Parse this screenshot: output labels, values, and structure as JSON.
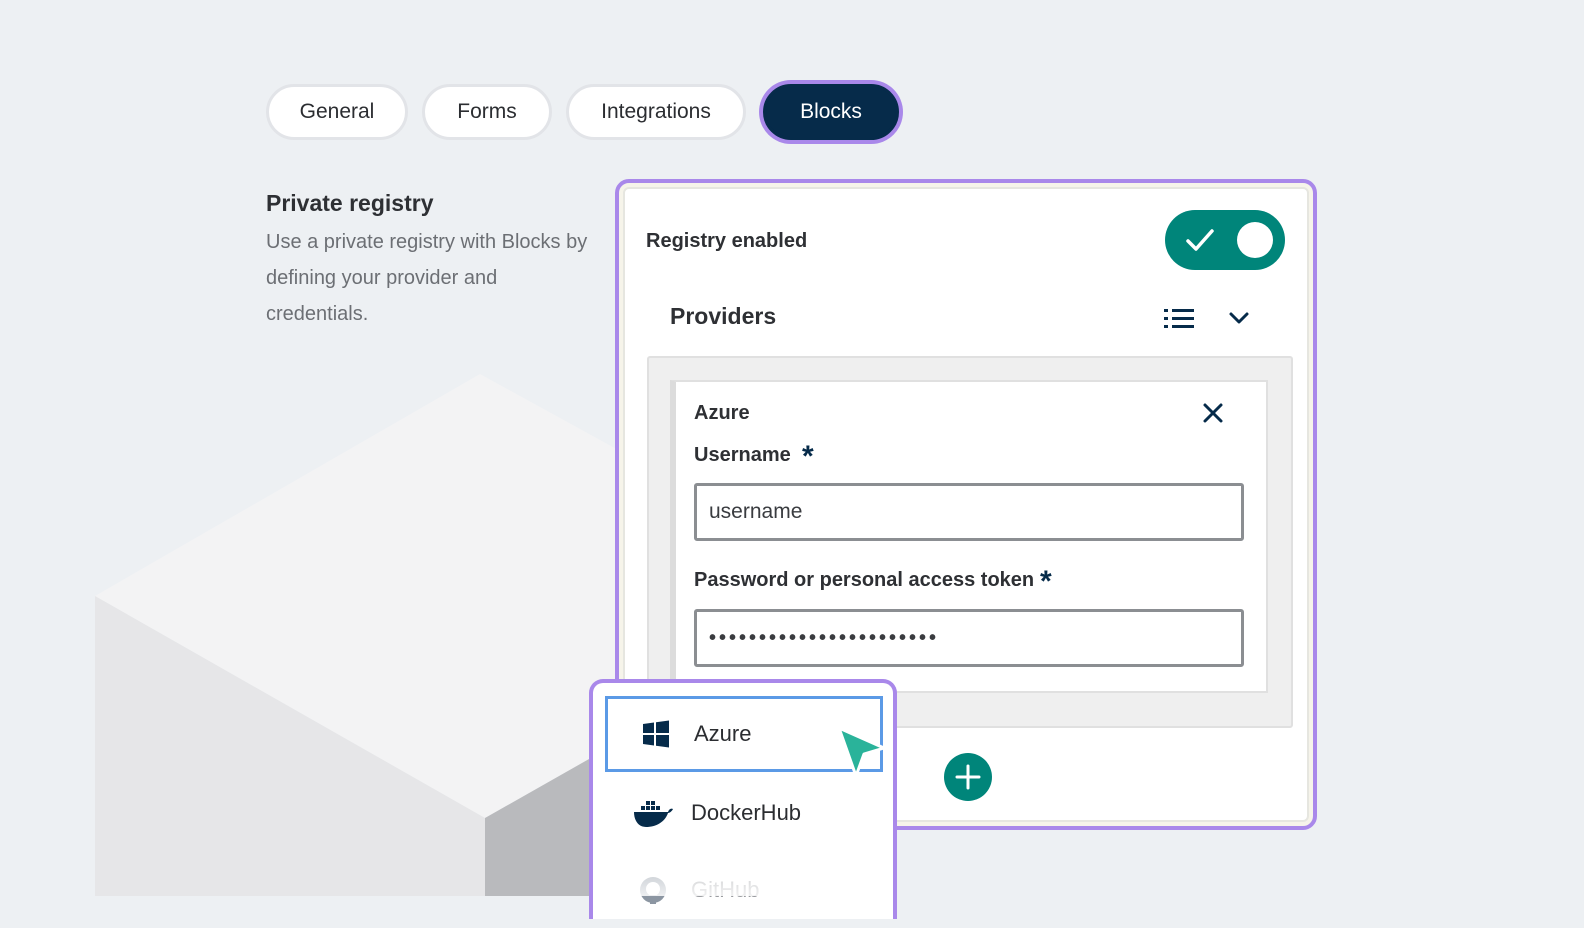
{
  "tabs": [
    {
      "label": "General"
    },
    {
      "label": "Forms"
    },
    {
      "label": "Integrations"
    },
    {
      "label": "Blocks",
      "active": true
    }
  ],
  "description": {
    "title": "Private registry",
    "text": "Use a private registry with Blocks by defining your provider and credentials."
  },
  "panel": {
    "registry_label": "Registry enabled",
    "registry_enabled": true,
    "providers_title": "Providers",
    "list_icon": "list-icon",
    "collapse_icon": "chevron-down-icon",
    "provider_card": {
      "name": "Azure",
      "username_label": "Username",
      "username_placeholder": "username",
      "password_label": "Password or personal access token",
      "password_value": "•••••••••••••••••••••••",
      "required_mark": "*"
    },
    "add_icon": "plus-icon"
  },
  "provider_dropdown": {
    "items": [
      {
        "label": "Azure",
        "icon": "windows-icon",
        "selected": true
      },
      {
        "label": "DockerHub",
        "icon": "docker-icon"
      },
      {
        "label": "GitHub",
        "icon": "github-icon"
      }
    ]
  },
  "colors": {
    "accent_purple": "#a988ea",
    "navy": "#062b4a",
    "teal": "#00857a",
    "cursor_teal": "#2ab39a",
    "select_blue": "#5b9ae6"
  }
}
